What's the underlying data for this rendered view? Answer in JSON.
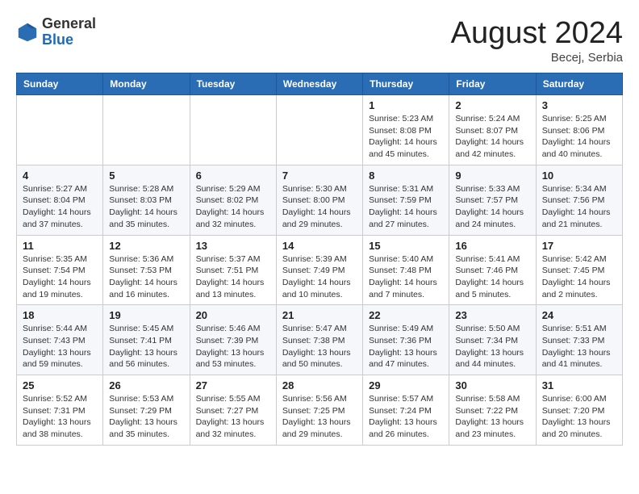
{
  "header": {
    "logo_general": "General",
    "logo_blue": "Blue",
    "month_title": "August 2024",
    "location": "Becej, Serbia"
  },
  "weekdays": [
    "Sunday",
    "Monday",
    "Tuesday",
    "Wednesday",
    "Thursday",
    "Friday",
    "Saturday"
  ],
  "weeks": [
    [
      {
        "day": "",
        "info": ""
      },
      {
        "day": "",
        "info": ""
      },
      {
        "day": "",
        "info": ""
      },
      {
        "day": "",
        "info": ""
      },
      {
        "day": "1",
        "info": "Sunrise: 5:23 AM\nSunset: 8:08 PM\nDaylight: 14 hours\nand 45 minutes."
      },
      {
        "day": "2",
        "info": "Sunrise: 5:24 AM\nSunset: 8:07 PM\nDaylight: 14 hours\nand 42 minutes."
      },
      {
        "day": "3",
        "info": "Sunrise: 5:25 AM\nSunset: 8:06 PM\nDaylight: 14 hours\nand 40 minutes."
      }
    ],
    [
      {
        "day": "4",
        "info": "Sunrise: 5:27 AM\nSunset: 8:04 PM\nDaylight: 14 hours\nand 37 minutes."
      },
      {
        "day": "5",
        "info": "Sunrise: 5:28 AM\nSunset: 8:03 PM\nDaylight: 14 hours\nand 35 minutes."
      },
      {
        "day": "6",
        "info": "Sunrise: 5:29 AM\nSunset: 8:02 PM\nDaylight: 14 hours\nand 32 minutes."
      },
      {
        "day": "7",
        "info": "Sunrise: 5:30 AM\nSunset: 8:00 PM\nDaylight: 14 hours\nand 29 minutes."
      },
      {
        "day": "8",
        "info": "Sunrise: 5:31 AM\nSunset: 7:59 PM\nDaylight: 14 hours\nand 27 minutes."
      },
      {
        "day": "9",
        "info": "Sunrise: 5:33 AM\nSunset: 7:57 PM\nDaylight: 14 hours\nand 24 minutes."
      },
      {
        "day": "10",
        "info": "Sunrise: 5:34 AM\nSunset: 7:56 PM\nDaylight: 14 hours\nand 21 minutes."
      }
    ],
    [
      {
        "day": "11",
        "info": "Sunrise: 5:35 AM\nSunset: 7:54 PM\nDaylight: 14 hours\nand 19 minutes."
      },
      {
        "day": "12",
        "info": "Sunrise: 5:36 AM\nSunset: 7:53 PM\nDaylight: 14 hours\nand 16 minutes."
      },
      {
        "day": "13",
        "info": "Sunrise: 5:37 AM\nSunset: 7:51 PM\nDaylight: 14 hours\nand 13 minutes."
      },
      {
        "day": "14",
        "info": "Sunrise: 5:39 AM\nSunset: 7:49 PM\nDaylight: 14 hours\nand 10 minutes."
      },
      {
        "day": "15",
        "info": "Sunrise: 5:40 AM\nSunset: 7:48 PM\nDaylight: 14 hours\nand 7 minutes."
      },
      {
        "day": "16",
        "info": "Sunrise: 5:41 AM\nSunset: 7:46 PM\nDaylight: 14 hours\nand 5 minutes."
      },
      {
        "day": "17",
        "info": "Sunrise: 5:42 AM\nSunset: 7:45 PM\nDaylight: 14 hours\nand 2 minutes."
      }
    ],
    [
      {
        "day": "18",
        "info": "Sunrise: 5:44 AM\nSunset: 7:43 PM\nDaylight: 13 hours\nand 59 minutes."
      },
      {
        "day": "19",
        "info": "Sunrise: 5:45 AM\nSunset: 7:41 PM\nDaylight: 13 hours\nand 56 minutes."
      },
      {
        "day": "20",
        "info": "Sunrise: 5:46 AM\nSunset: 7:39 PM\nDaylight: 13 hours\nand 53 minutes."
      },
      {
        "day": "21",
        "info": "Sunrise: 5:47 AM\nSunset: 7:38 PM\nDaylight: 13 hours\nand 50 minutes."
      },
      {
        "day": "22",
        "info": "Sunrise: 5:49 AM\nSunset: 7:36 PM\nDaylight: 13 hours\nand 47 minutes."
      },
      {
        "day": "23",
        "info": "Sunrise: 5:50 AM\nSunset: 7:34 PM\nDaylight: 13 hours\nand 44 minutes."
      },
      {
        "day": "24",
        "info": "Sunrise: 5:51 AM\nSunset: 7:33 PM\nDaylight: 13 hours\nand 41 minutes."
      }
    ],
    [
      {
        "day": "25",
        "info": "Sunrise: 5:52 AM\nSunset: 7:31 PM\nDaylight: 13 hours\nand 38 minutes."
      },
      {
        "day": "26",
        "info": "Sunrise: 5:53 AM\nSunset: 7:29 PM\nDaylight: 13 hours\nand 35 minutes."
      },
      {
        "day": "27",
        "info": "Sunrise: 5:55 AM\nSunset: 7:27 PM\nDaylight: 13 hours\nand 32 minutes."
      },
      {
        "day": "28",
        "info": "Sunrise: 5:56 AM\nSunset: 7:25 PM\nDaylight: 13 hours\nand 29 minutes."
      },
      {
        "day": "29",
        "info": "Sunrise: 5:57 AM\nSunset: 7:24 PM\nDaylight: 13 hours\nand 26 minutes."
      },
      {
        "day": "30",
        "info": "Sunrise: 5:58 AM\nSunset: 7:22 PM\nDaylight: 13 hours\nand 23 minutes."
      },
      {
        "day": "31",
        "info": "Sunrise: 6:00 AM\nSunset: 7:20 PM\nDaylight: 13 hours\nand 20 minutes."
      }
    ]
  ]
}
